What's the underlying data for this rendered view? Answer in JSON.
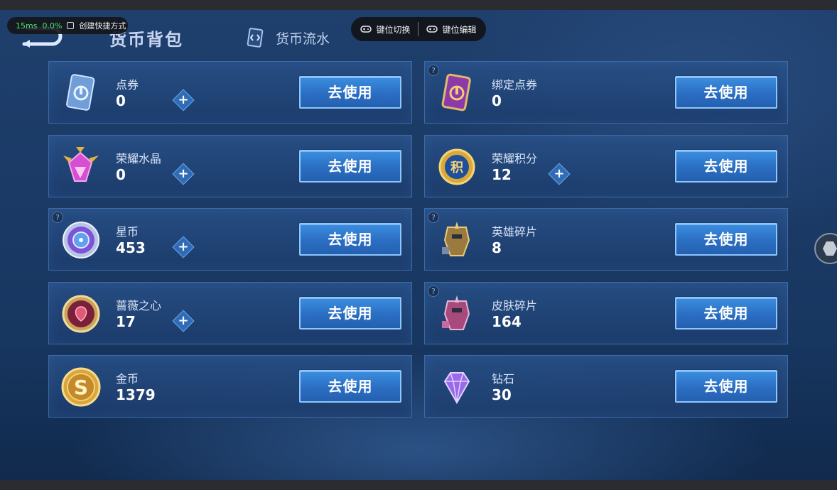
{
  "overlay": {
    "latency": "15ms",
    "loss": "0.0%",
    "shortcut_label": "创建快捷方式",
    "key_switch_label": "键位切换",
    "key_edit_label": "键位编辑"
  },
  "header": {
    "title": "货币背包",
    "flow_tab": "货币流水"
  },
  "action_label": "去使用",
  "currencies": [
    {
      "name": "点券",
      "count": "0",
      "icon": "ticket-icon"
    },
    {
      "name": "绑定点券",
      "count": "0",
      "icon": "bound-ticket-icon"
    },
    {
      "name": "荣耀水晶",
      "count": "0",
      "icon": "crystal-icon"
    },
    {
      "name": "荣耀积分",
      "count": "12",
      "icon": "honor-points-icon"
    },
    {
      "name": "星币",
      "count": "453",
      "icon": "star-coin-icon"
    },
    {
      "name": "英雄碎片",
      "count": "8",
      "icon": "hero-fragment-icon"
    },
    {
      "name": "蔷薇之心",
      "count": "17",
      "icon": "rose-heart-icon"
    },
    {
      "name": "皮肤碎片",
      "count": "164",
      "icon": "skin-fragment-icon"
    },
    {
      "name": "金币",
      "count": "1379",
      "icon": "gold-coin-icon"
    },
    {
      "name": "钻石",
      "count": "30",
      "icon": "diamond-icon"
    }
  ],
  "colors": {
    "background": "#1b3a66",
    "card_border": "#3d6aa5",
    "button": "#2a6ec2",
    "button_border": "#8ec6ff"
  }
}
